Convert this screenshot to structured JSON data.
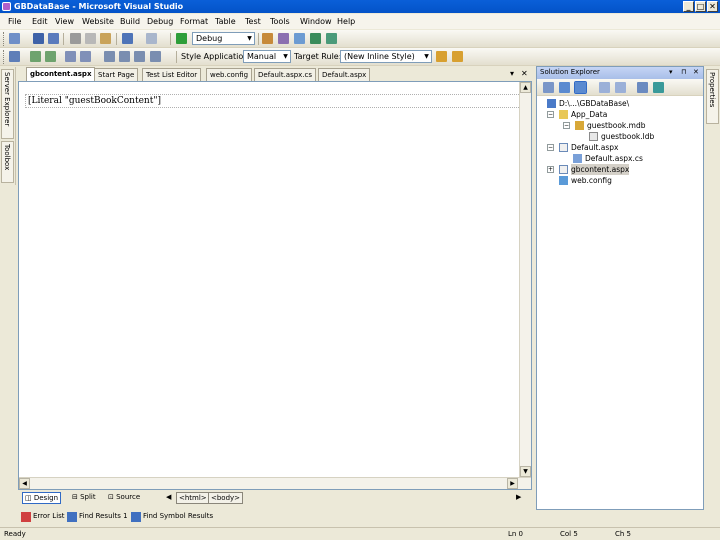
{
  "window": {
    "title": "GBDataBase - Microsoft Visual Studio",
    "controls": [
      "_",
      "□",
      "✕"
    ]
  },
  "menu": [
    "File",
    "Edit",
    "View",
    "Website",
    "Build",
    "Debug",
    "Format",
    "Table",
    "Test",
    "Tools",
    "Window",
    "Help"
  ],
  "toolbar": {
    "config_value": "Debug",
    "style_application_label": "Style Application:",
    "style_application_value": "Manual",
    "target_rule_label": "Target Rule:",
    "target_rule_value": "(New Inline Style)"
  },
  "left_tool_tabs": [
    "Server Explorer",
    "Toolbox"
  ],
  "right_tool_tabs": [
    "Properties"
  ],
  "doc_tabs": [
    {
      "label": "gbcontent.aspx",
      "active": true
    },
    {
      "label": "Start Page",
      "active": false
    },
    {
      "label": "Test List Editor",
      "active": false
    },
    {
      "label": "web.config",
      "active": false
    },
    {
      "label": "Default.aspx.cs",
      "active": false
    },
    {
      "label": "Default.aspx",
      "active": false
    }
  ],
  "doc_controls": {
    "dropdown": "▾",
    "close": "✕"
  },
  "editor": {
    "literal_text": "[Literal \"guestBookContent\"]"
  },
  "view_modes": {
    "design": "Design",
    "split": "Split",
    "source": "Source",
    "breadcrumbs": [
      "<html>",
      "<body>"
    ]
  },
  "bottom_tabs": [
    "Error List",
    "Find Results 1",
    "Find Symbol Results"
  ],
  "status": {
    "ready": "Ready",
    "line": "Ln 0",
    "col": "Col 5",
    "ch": "Ch 5"
  },
  "solution_explorer": {
    "title": "Solution Explorer",
    "header_controls": [
      "▾",
      "⊓",
      "✕"
    ],
    "tree": [
      {
        "label": "D:\\...\\GBDataBase\\",
        "level": 0,
        "expander": "",
        "icon": "project-icon",
        "selected": false
      },
      {
        "label": "App_Data",
        "level": 1,
        "expander": "−",
        "icon": "folder-icon",
        "selected": false
      },
      {
        "label": "guestbook.mdb",
        "level": 2,
        "expander": "−",
        "icon": "database-icon",
        "selected": false
      },
      {
        "label": "guestbook.ldb",
        "level": 3,
        "expander": "",
        "icon": "file-icon",
        "selected": false
      },
      {
        "label": "Default.aspx",
        "level": 1,
        "expander": "−",
        "icon": "aspx-icon",
        "selected": false
      },
      {
        "label": "Default.aspx.cs",
        "level": 2,
        "expander": "",
        "icon": "cs-icon",
        "selected": false
      },
      {
        "label": "gbcontent.aspx",
        "level": 1,
        "expander": "+",
        "icon": "aspx-icon",
        "selected": true
      },
      {
        "label": "web.config",
        "level": 1,
        "expander": "",
        "icon": "config-icon",
        "selected": false
      }
    ]
  }
}
